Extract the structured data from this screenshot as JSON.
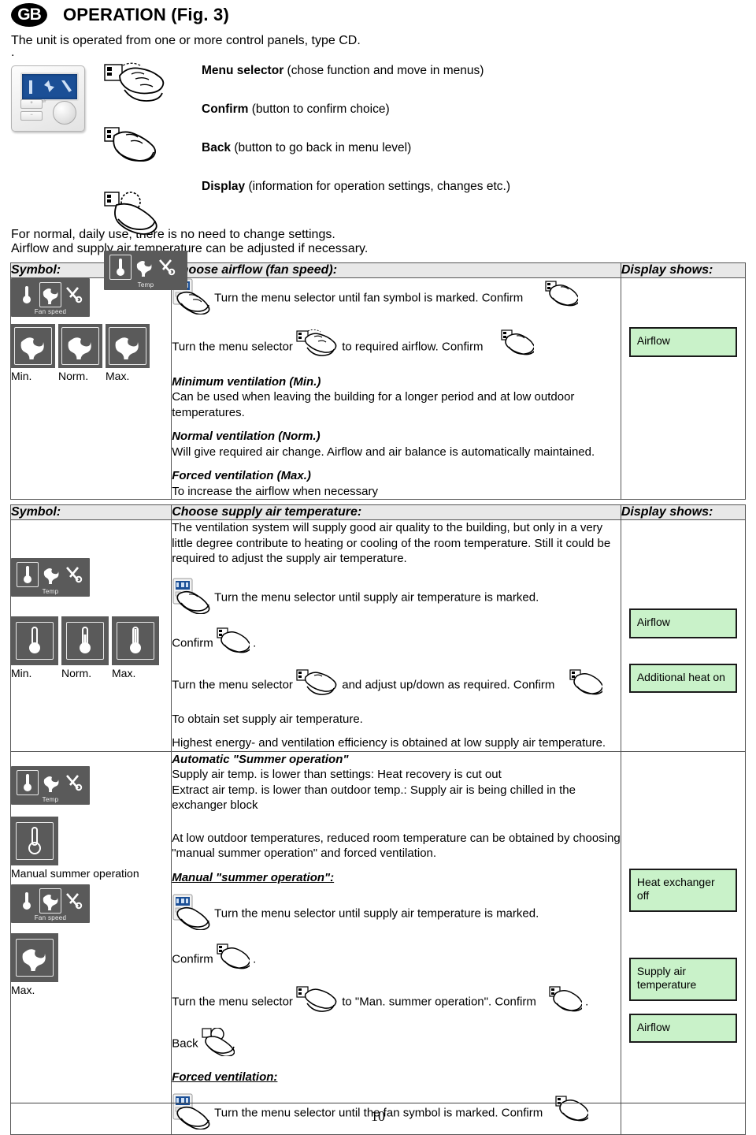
{
  "header": {
    "country_badge": "GB",
    "title": "OPERATION (Fig. 3)",
    "intro": "The unit is operated from one or more control panels, type CD.",
    "stray_dot": "."
  },
  "controls": [
    {
      "term": "Menu selector",
      "desc": " (chose function and move in menus)",
      "icon": "hand-turn-knob-icon"
    },
    {
      "term": "Confirm",
      "desc": " (button to confirm choice)",
      "icon": "hand-press-confirm-icon"
    },
    {
      "term": "Back",
      "desc": " (button to go back in menu level)",
      "icon": "hand-press-back-icon"
    },
    {
      "term": "Display",
      "desc": " (information for operation settings, changes etc.)",
      "icon": "display-temp-menu-icon"
    }
  ],
  "notes": [
    "For normal, daily use, there is no need to change settings.",
    "Airflow and supply air temperature can be adjusted if necessary."
  ],
  "table_headers": {
    "symbol": "Symbol:",
    "airflow_section": "Choose airflow (fan speed):",
    "temperature_section": "Choose supply air temperature:",
    "display": "Display shows:"
  },
  "section_airflow": {
    "symbol": {
      "menu_label": "Fan speed",
      "tiles": [
        "Min.",
        "Norm.",
        "Max."
      ]
    },
    "steps": [
      {
        "text": "Turn the menu selector until fan symbol is marked. Confirm",
        "lead_icon": "panel-hand-icon",
        "trail_icon": "hand-press-confirm-icon"
      },
      {
        "text_before": "Turn the menu selector",
        "mid_icon": "hand-turn-knob-icon",
        "text_after": "to required airflow. Confirm",
        "trail_icon": "hand-press-confirm-icon"
      }
    ],
    "modes": [
      {
        "heading": "Minimum ventilation (Min.)",
        "body": "Can be used when leaving the building for a longer period and at low outdoor temperatures."
      },
      {
        "heading": "Normal ventilation (Norm.)",
        "body": "Will give required air change. Airflow and air balance is automatically maintained."
      },
      {
        "heading": "Forced ventilation (Max.)",
        "body": "To increase the airflow when necessary"
      }
    ],
    "display": "Airflow"
  },
  "section_temperature": {
    "symbol": {
      "menu_label": "Temp",
      "tiles": [
        "Min.",
        "Norm.",
        "Max."
      ]
    },
    "intro": "The ventilation system will supply good air quality to the building, but only in a very little degree contribute to heating or cooling of the room temperature. Still it could be required to adjust the supply air temperature.",
    "step_mark": "Turn the menu selector until supply air temperature is marked.",
    "confirm_label": "Confirm",
    "confirm_period": ".",
    "step_adjust_before": "Turn the menu selector",
    "step_adjust_after": "and adjust up/down as required. Confirm",
    "obtain": "To obtain set supply air temperature.",
    "efficiency": "Highest energy- and ventilation efficiency is obtained at low supply air temperature.",
    "display_airflow": "Airflow",
    "display_additional_heat": "Additional heat on"
  },
  "section_summer": {
    "auto_heading": "Automatic \"Summer operation\"",
    "auto_lines": [
      "Supply air temp. is lower than settings:  Heat recovery is cut out",
      "Extract air temp. is lower than outdoor temp.: Supply air is being chilled in the exchanger block"
    ],
    "low_outdoor": "At low outdoor temperatures, reduced room temperature can be obtained by choosing \"manual summer operation\" and forced ventilation.",
    "manual_heading": "Manual \"summer operation\":",
    "step_mark": "Turn the menu selector until supply air temperature is marked.",
    "confirm_label": "Confirm",
    "confirm_period": ".",
    "step_man_before": "Turn the menu selector",
    "step_man_after": "to \"Man. summer operation\". Confirm",
    "step_man_period": ".",
    "back_label": "Back",
    "forced_heading": "Forced  ventilation:",
    "forced_step": "Turn the menu selector until the fan symbol is marked. Confirm",
    "symbol_menu_label_temp": "Temp",
    "symbol_caption_manual": "Manual summer operation",
    "symbol_menu_label_fan": "Fan speed",
    "symbol_caption_max": "Max.",
    "display_heat_exchanger_off": "Heat exchanger off",
    "display_supply_air_temperature": "Supply air temperature",
    "display_airflow": "Airflow"
  },
  "footer": {
    "page_number": "10"
  },
  "colors": {
    "display_box_bg": "#c9f2c9",
    "display_box_border": "#1a1a1a",
    "header_row_bg": "#e8e8e8",
    "icon_panel_bg": "#5a5a5a",
    "lcd_blue": "#1b4f96"
  }
}
